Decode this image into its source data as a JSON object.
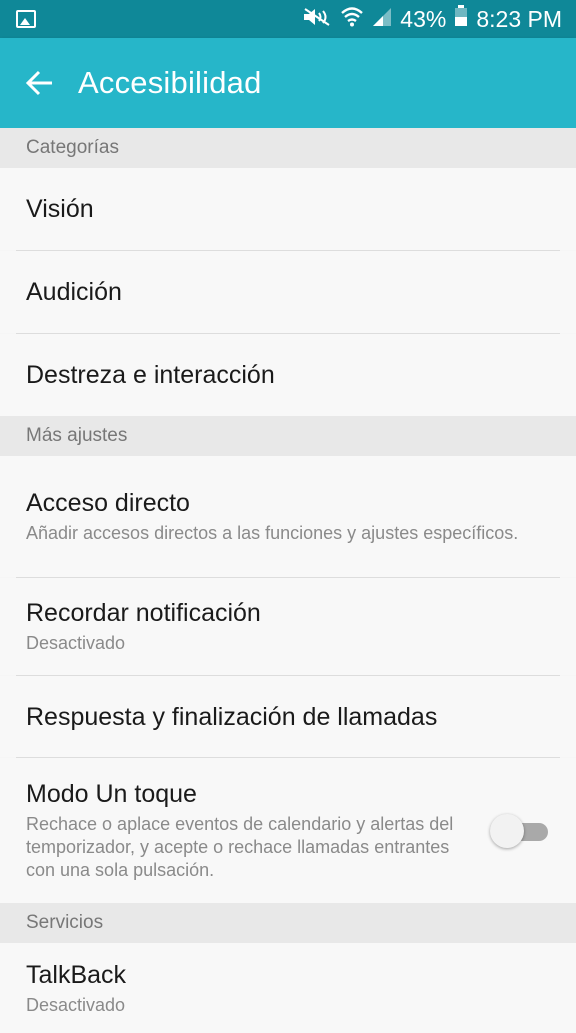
{
  "status_bar": {
    "battery": "43%",
    "time": "8:23 PM",
    "icons": [
      "image-icon",
      "mute-icon",
      "wifi-icon",
      "signal-icon",
      "battery-icon"
    ]
  },
  "app_bar": {
    "title": "Accesibilidad",
    "back_icon": "arrow-back-icon"
  },
  "colors": {
    "status_bar": "#0f8898",
    "app_bar": "#26b6c9"
  },
  "sections": [
    {
      "header": "Categorías",
      "items": [
        {
          "title": "Visión"
        },
        {
          "title": "Audición"
        },
        {
          "title": "Destreza e interacción"
        }
      ]
    },
    {
      "header": "Más ajustes",
      "items": [
        {
          "title": "Acceso directo",
          "subtitle": "Añadir accesos directos a las funciones y ajustes específicos."
        },
        {
          "title": "Recordar notificación",
          "subtitle": "Desactivado"
        },
        {
          "title": "Respuesta y finalización de llamadas"
        },
        {
          "title": "Modo Un toque",
          "subtitle": "Rechace o aplace eventos de calendario y alertas del temporizador, y acepte o rechace llamadas entrantes con una sola pulsación.",
          "toggle_on": false
        }
      ]
    },
    {
      "header": "Servicios",
      "items": [
        {
          "title": "TalkBack",
          "subtitle": "Desactivado"
        }
      ]
    }
  ]
}
